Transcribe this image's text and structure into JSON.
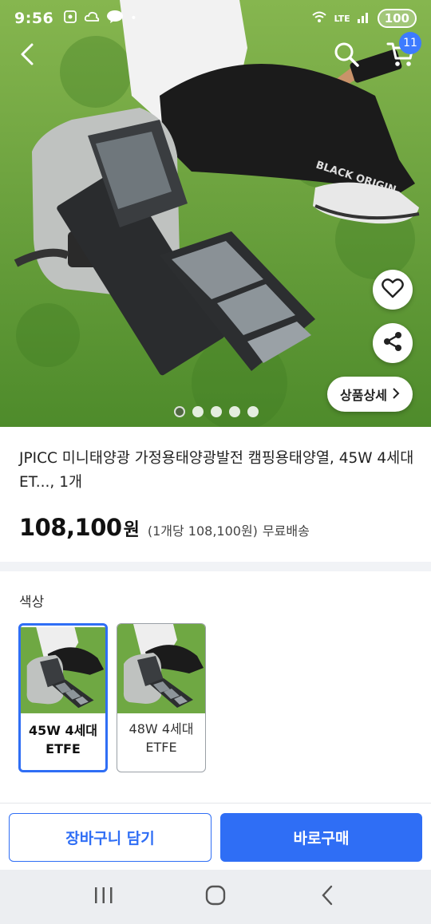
{
  "status_bar": {
    "time": "9:56",
    "left_icons": [
      "screenshot-icon",
      "cloud-icon",
      "talk-icon"
    ],
    "right_icons": [
      "wifi-icon",
      "lte-icon",
      "signal-icon"
    ],
    "battery": "100"
  },
  "header": {
    "cart_count": "11"
  },
  "hero": {
    "detail_button_label": "상품상세",
    "dot_count": 5,
    "active_dot": 0
  },
  "product": {
    "title": "JPICC 미니태양광 가정용태양광발전 캠핑용태양열, 45W 4세대 ET..., 1개",
    "price": "108,100",
    "price_unit": "원",
    "unit_price": "(1개당 108,100원)",
    "shipping": "무료배송"
  },
  "options": {
    "label": "색상",
    "items": [
      {
        "line1": "45W 4세대",
        "line2": "ETFE",
        "selected": true
      },
      {
        "line1": "48W 4세대",
        "line2": "ETFE",
        "selected": false
      }
    ]
  },
  "actions": {
    "add_to_cart": "장바구니 담기",
    "buy_now": "바로구매"
  },
  "colors": {
    "accent": "#2f6ef5",
    "badge": "#3d7bff"
  }
}
